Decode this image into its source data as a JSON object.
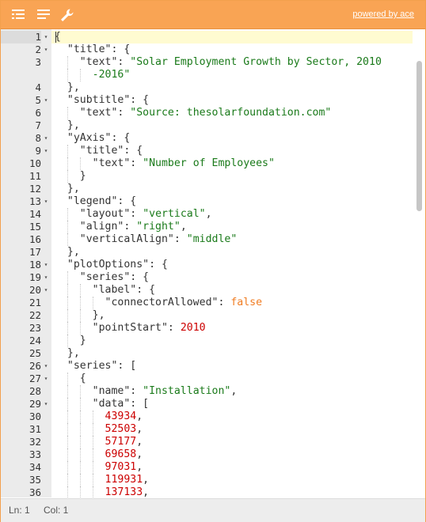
{
  "toolbar": {
    "powered_label": "powered by ace",
    "icons": [
      "indent-lines-icon",
      "format-lines-icon",
      "wrench-icon"
    ]
  },
  "editor": {
    "lines": [
      {
        "num": "1",
        "fold": true,
        "code": "{"
      },
      {
        "num": "2",
        "fold": true,
        "code": "  \"title\": {"
      },
      {
        "num": "3",
        "fold": false,
        "code": "    \"text\": \"Solar Employment Growth by Sector, 2010\n      -2016\""
      },
      {
        "num": "4",
        "fold": false,
        "code": "  },"
      },
      {
        "num": "5",
        "fold": true,
        "code": "  \"subtitle\": {"
      },
      {
        "num": "6",
        "fold": false,
        "code": "    \"text\": \"Source: thesolarfoundation.com\""
      },
      {
        "num": "7",
        "fold": false,
        "code": "  },"
      },
      {
        "num": "8",
        "fold": true,
        "code": "  \"yAxis\": {"
      },
      {
        "num": "9",
        "fold": true,
        "code": "    \"title\": {"
      },
      {
        "num": "10",
        "fold": false,
        "code": "      \"text\": \"Number of Employees\""
      },
      {
        "num": "11",
        "fold": false,
        "code": "    }"
      },
      {
        "num": "12",
        "fold": false,
        "code": "  },"
      },
      {
        "num": "13",
        "fold": true,
        "code": "  \"legend\": {"
      },
      {
        "num": "14",
        "fold": false,
        "code": "    \"layout\": \"vertical\","
      },
      {
        "num": "15",
        "fold": false,
        "code": "    \"align\": \"right\","
      },
      {
        "num": "16",
        "fold": false,
        "code": "    \"verticalAlign\": \"middle\""
      },
      {
        "num": "17",
        "fold": false,
        "code": "  },"
      },
      {
        "num": "18",
        "fold": true,
        "code": "  \"plotOptions\": {"
      },
      {
        "num": "19",
        "fold": true,
        "code": "    \"series\": {"
      },
      {
        "num": "20",
        "fold": true,
        "code": "      \"label\": {"
      },
      {
        "num": "21",
        "fold": false,
        "code": "        \"connectorAllowed\": false"
      },
      {
        "num": "22",
        "fold": false,
        "code": "      },"
      },
      {
        "num": "23",
        "fold": false,
        "code": "      \"pointStart\": 2010"
      },
      {
        "num": "24",
        "fold": false,
        "code": "    }"
      },
      {
        "num": "25",
        "fold": false,
        "code": "  },"
      },
      {
        "num": "26",
        "fold": true,
        "code": "  \"series\": ["
      },
      {
        "num": "27",
        "fold": true,
        "code": "    {"
      },
      {
        "num": "28",
        "fold": false,
        "code": "      \"name\": \"Installation\","
      },
      {
        "num": "29",
        "fold": true,
        "code": "      \"data\": ["
      },
      {
        "num": "30",
        "fold": false,
        "code": "        43934,"
      },
      {
        "num": "31",
        "fold": false,
        "code": "        52503,"
      },
      {
        "num": "32",
        "fold": false,
        "code": "        57177,"
      },
      {
        "num": "33",
        "fold": false,
        "code": "        69658,"
      },
      {
        "num": "34",
        "fold": false,
        "code": "        97031,"
      },
      {
        "num": "35",
        "fold": false,
        "code": "        119931,"
      },
      {
        "num": "36",
        "fold": false,
        "code": "        137133,"
      }
    ]
  },
  "statusbar": {
    "line_label": "Ln: 1",
    "col_label": "Col: 1"
  },
  "colors": {
    "toolbar_bg": "#f9a454",
    "string": "#1a7a1a",
    "number": "#cc0000",
    "boolean": "#f07c22",
    "active_line": "#fffbd1"
  }
}
